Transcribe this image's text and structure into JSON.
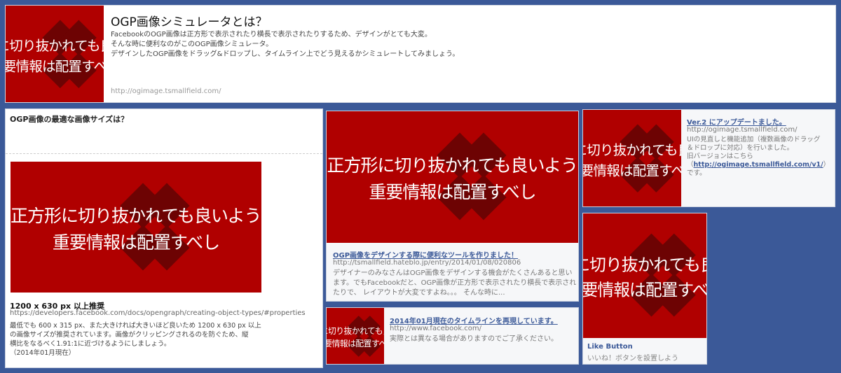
{
  "og_image": {
    "line1": "正方形に切り抜かれても良いように",
    "line2": "重要情報は配置すべし"
  },
  "top": {
    "title": "OGP画像シミュレータとは？",
    "desc": [
      "FacebookのOGP画像は正方形で表示されたり横長で表示されたりするため、デザインがとても大変。",
      "そんな時に便利なのがこのOGP画像シミュレータ。",
      "デザインしたOGP画像をドラッグ&ドロップし、タイムライン上でどう見えるかシミュレートしてみましょう。"
    ],
    "url": "http://ogimage.tsmallfield.com/"
  },
  "size_card": {
    "header": "OGP画像の最適な画像サイズは？",
    "title": "1200 x 630 px 以上推奨",
    "url": "https://developers.facebook.com/docs/opengraph/creating-object-types/#properties",
    "desc": [
      "最低でも 600 x 315 px、また大きければ大きいほど良いため 1200 x 630 px 以上",
      "の画像サイズが推奨されています。画像がクリッピングされるのを防ぐため、縦",
      "横比をなるべく1.91:1に近づけるようにしましょう。",
      "（2014年01月現在）"
    ]
  },
  "blog_card": {
    "title": "OGP画像をデザインする際に便利なツールを作りました！",
    "url": "http://tsmallfield.hateblo.jp/entry/2014/01/08/020806",
    "desc": [
      "デザイナーのみなさんはOGP画像をデザインする機会がたくさんあると思い",
      "ます。でもFacebookだと、OGP画像が正方形で表示されたり横長で表示され",
      "たりで、 レイアウトが大変ですよね。。。 そんな時に..."
    ]
  },
  "timeline_card": {
    "title": "2014年01月現在のタイムラインを再現しています。",
    "url": "http://www.facebook.com/",
    "desc": "実際とは異なる場合がありますのでご了承ください。"
  },
  "update_card": {
    "title": "Ver.2 にアップデートました。",
    "url": "http://ogimage.tsmallfield.com/",
    "desc": [
      "UIの見直しと機能追加（複数画像のドラッグ",
      "＆ドロップに対応）を行いました。",
      "旧バージョンはこちら"
    ],
    "link_open": "（",
    "link": "http://ogimage.tsmallfield.com/v1/",
    "link_close": "）",
    "tail": "です。"
  },
  "like_card": {
    "title": "Like Button",
    "desc": "いいね！ボタンを設置しよう"
  }
}
